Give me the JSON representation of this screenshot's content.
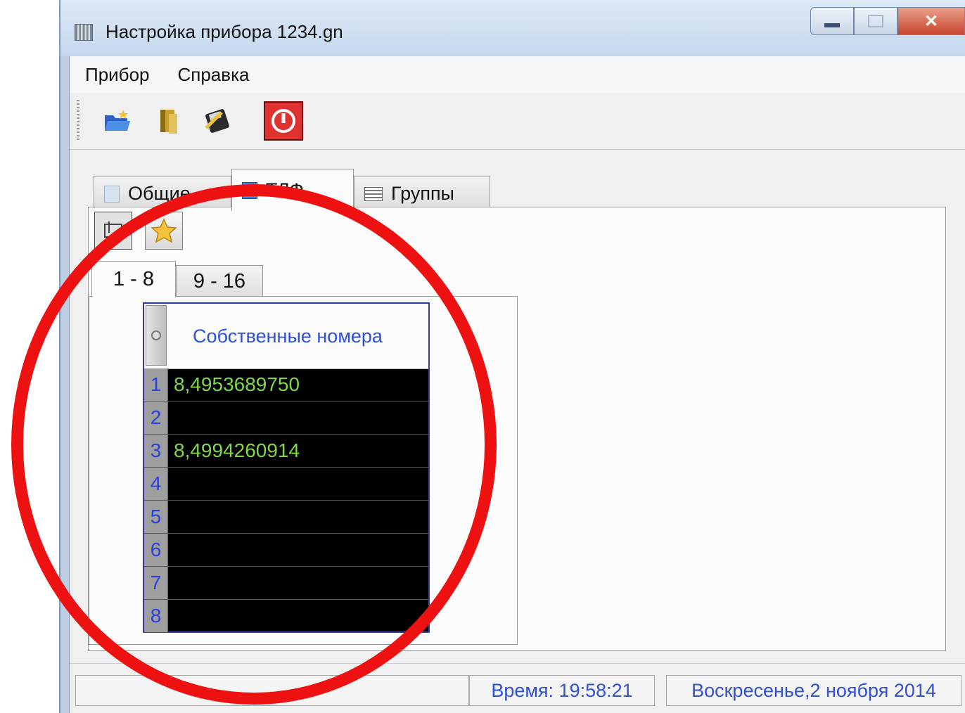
{
  "window": {
    "title": "Настройка прибора 1234.gn"
  },
  "menu": [
    "Прибор",
    "Справка"
  ],
  "tabs": [
    "Общие",
    "ТЛФ",
    "Группы"
  ],
  "subtabs": [
    "1 - 8",
    "9 - 16"
  ],
  "grid": {
    "header": "Собственные номера",
    "rows": [
      {
        "num": "1",
        "value": "8,4953689750"
      },
      {
        "num": "2",
        "value": ""
      },
      {
        "num": "3",
        "value": "8,4994260914"
      },
      {
        "num": "4",
        "value": ""
      },
      {
        "num": "5",
        "value": ""
      },
      {
        "num": "6",
        "value": ""
      },
      {
        "num": "7",
        "value": ""
      },
      {
        "num": "8",
        "value": ""
      }
    ]
  },
  "status": {
    "time": "Время: 19:58:21",
    "date": "Воскресенье,2 ноября 2014"
  },
  "icons": {
    "toolbar": [
      "open-folder-icon",
      "book-icon",
      "save-disk-icon",
      "power-icon"
    ],
    "panel": [
      "import-icon",
      "star-icon"
    ]
  },
  "colors": {
    "accent_text": "#2f4fd8",
    "value_text": "#7fd84a",
    "annotation": "#ee1111"
  }
}
